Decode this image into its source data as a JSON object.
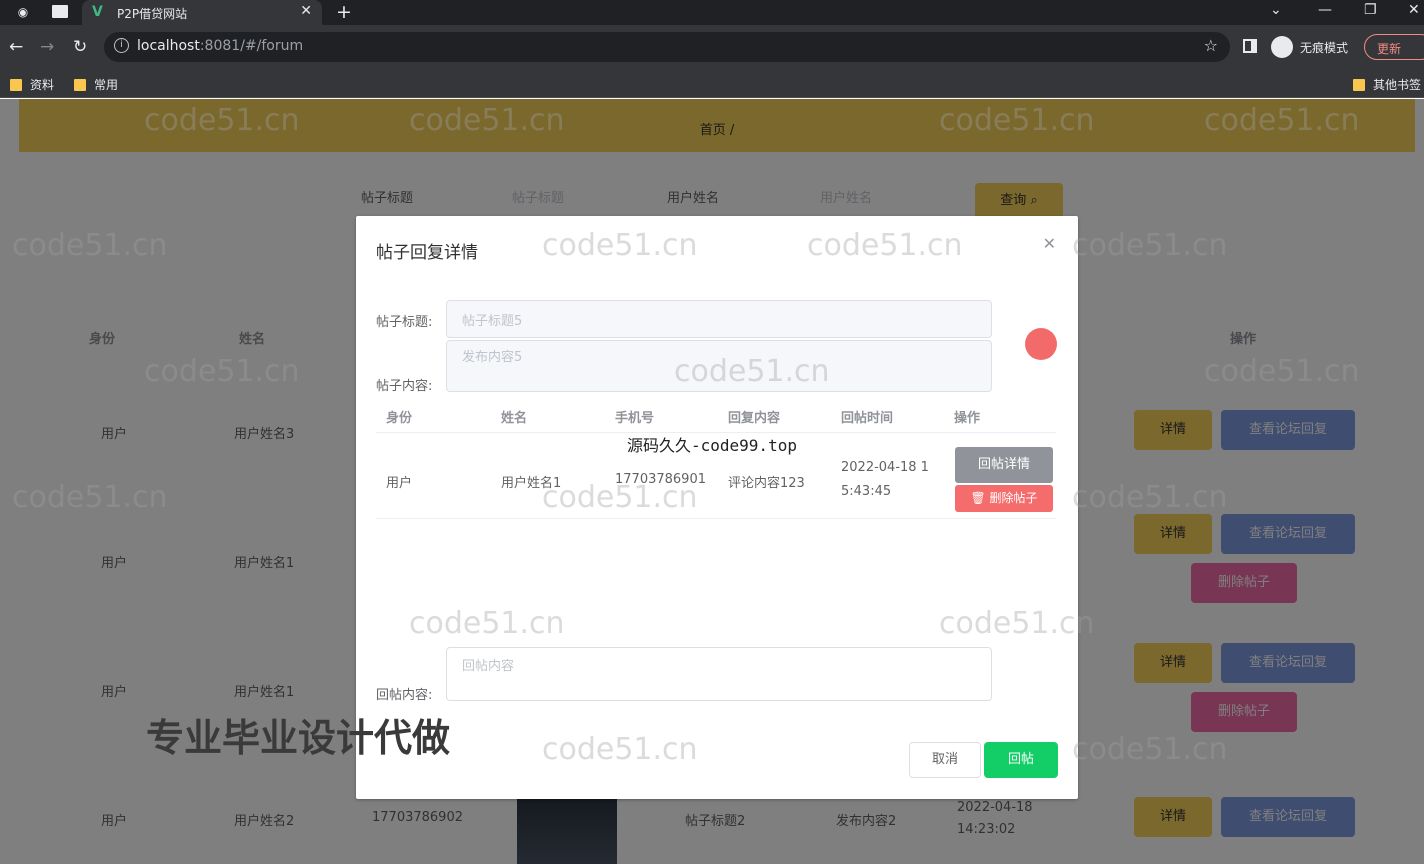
{
  "browser": {
    "tab_title": "P2P借贷网站",
    "url_host": "localhost",
    "url_rest": ":8081/#/forum",
    "incognito_label": "无痕模式",
    "update_label": "更新",
    "bookmarks": [
      "资料",
      "常用"
    ],
    "other_bookmarks": "其他书签"
  },
  "page": {
    "breadcrumb": "首页 /",
    "search": {
      "title_label": "帖子标题",
      "title_placeholder": "帖子标题",
      "name_label": "用户姓名",
      "name_placeholder": "用户姓名",
      "query_label": "查询"
    },
    "columns": {
      "identity": "身份",
      "name": "姓名",
      "actions": "操作"
    },
    "rows": [
      {
        "identity": "用户",
        "name": "用户姓名3"
      },
      {
        "identity": "用户",
        "name": "用户姓名1"
      },
      {
        "identity": "用户",
        "name": "用户姓名1"
      },
      {
        "identity": "用户",
        "name": "用户姓名2",
        "phone": "17703786902",
        "title": "帖子标题2",
        "content": "发布内容2",
        "time": "2022-04-18 14:23:02"
      }
    ],
    "actions": {
      "detail": "详情",
      "view_replies": "查看论坛回复",
      "delete": "删除帖子"
    }
  },
  "dialog": {
    "title": "帖子回复详情",
    "post_title_label": "帖子标题:",
    "post_title_value": "帖子标题5",
    "post_content_label": "帖子内容:",
    "post_content_value": "发布内容5",
    "table": {
      "headers": [
        "身份",
        "姓名",
        "手机号",
        "回复内容",
        "回帖时间",
        "操作"
      ],
      "row": {
        "identity": "用户",
        "name": "用户姓名1",
        "phone": "17703786901",
        "content": "评论内容123",
        "time_line1": "2022-04-18 1",
        "time_line2": "5:43:45",
        "detail_btn": "回帖详情",
        "delete_btn": "删除帖子"
      }
    },
    "reply_label": "回帖内容:",
    "reply_placeholder": "回帖内容",
    "cancel": "取消",
    "submit": "回帖"
  },
  "overlay_text": {
    "center_mark": "源码久久-code99.top",
    "promo": "专业毕业设计代做",
    "watermark": "code51.cn"
  }
}
